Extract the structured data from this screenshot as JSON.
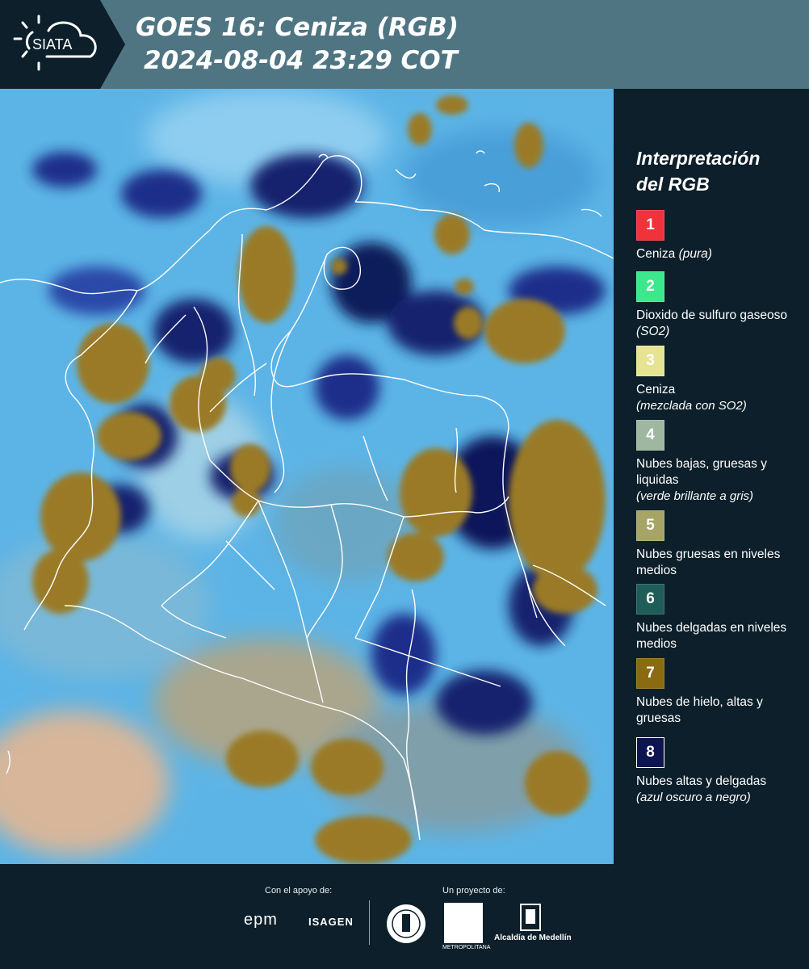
{
  "header": {
    "logo_text": "SIATA",
    "title_line1": "GOES 16: Ceniza (RGB)",
    "title_line2": "2024-08-04 23:29 COT"
  },
  "legend": {
    "title_line1": "Interpretación",
    "title_line2": "del RGB",
    "items": [
      {
        "number": "1",
        "color": "#f0323a",
        "label": "Ceniza",
        "inline_sub": "(pura)",
        "sub": ""
      },
      {
        "number": "2",
        "color": "#3be88b",
        "label": "Dioxido de sulfuro gaseoso",
        "inline_sub": "(SO2)",
        "sub": ""
      },
      {
        "number": "3",
        "color": "#e6e493",
        "label": "Ceniza",
        "inline_sub": "",
        "sub": "(mezclada con SO2)"
      },
      {
        "number": "4",
        "color": "#9fb7a0",
        "label": "Nubes bajas, gruesas y liquidas",
        "inline_sub": "",
        "sub": "(verde brillante a gris)"
      },
      {
        "number": "5",
        "color": "#a6a566",
        "label": "Nubes gruesas en niveles medios",
        "inline_sub": "",
        "sub": ""
      },
      {
        "number": "6",
        "color": "#1f5e58",
        "label": "Nubes delgadas en niveles medios",
        "inline_sub": "",
        "sub": ""
      },
      {
        "number": "7",
        "color": "#8a6b12",
        "label": "Nubes de hielo, altas y gruesas",
        "inline_sub": "",
        "sub": ""
      },
      {
        "number": "8",
        "color": "#0c1452",
        "label": "Nubes altas y delgadas",
        "inline_sub": "",
        "sub": "(azul oscuro a negro)"
      }
    ]
  },
  "footer": {
    "support_label": "Con el apoyo de:",
    "project_label": "Un proyecto de:",
    "epm": "epm",
    "isagen": "ISAGEN",
    "area_metropolitana": "METROPOLITANA",
    "alcaldia": "Alcaldía de Medellín"
  },
  "colors": {
    "header_bg": "#4f7583",
    "logo_bg": "#0c1f2a",
    "panel_bg": "#0c1f2a",
    "sky_blue": "#5cb4e6",
    "ice_cloud": "#9a7a26",
    "thin_high_cloud": "#0c1452"
  }
}
